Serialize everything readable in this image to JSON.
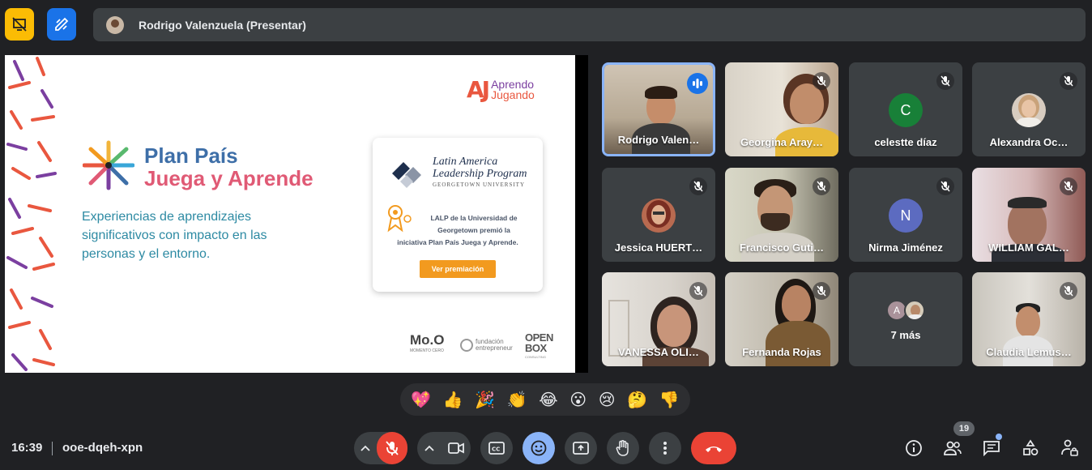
{
  "header": {
    "presenter_label": "Rodrigo Valenzuela (Presentar)",
    "left_buttons": [
      "present-off-icon",
      "whiteboard-icon"
    ]
  },
  "slide": {
    "brand_top_right": {
      "mark": "AJ",
      "line1": "Aprendo",
      "line2": "Jugando"
    },
    "title_line1": "Plan País",
    "title_line2": "Juega y Aprende",
    "subtitle_lines": [
      "Experiencias de aprendizajes",
      "significativos con impacto en las",
      "personas y el entorno."
    ],
    "card": {
      "program_line1": "Latin America",
      "program_line2": "Leadership Program",
      "university": "GEORGETOWN UNIVERSITY",
      "text_lines": [
        "LALP de la Universidad de",
        "Georgetown premió la",
        "iniciativa Plan País Juega y Aprende."
      ],
      "button": "Ver premiación"
    },
    "sponsors": {
      "mo": "Mo.O",
      "mo_sub": "MOMENTO CERO",
      "fundacion_1": "fundación",
      "fundacion_2": "entrepreneur",
      "openbox_1": "OPEN",
      "openbox_2": "BOX",
      "openbox_sub": "CONSULTING"
    }
  },
  "participants": [
    {
      "name": "Rodrigo Valen…",
      "type": "video",
      "speaking": true
    },
    {
      "name": "Georgina Aray…",
      "type": "video",
      "muted": true
    },
    {
      "name": "celestte díaz",
      "type": "letter",
      "letter": "C",
      "color": "#188038",
      "muted": true
    },
    {
      "name": "Alexandra Oc…",
      "type": "photo",
      "muted": true
    },
    {
      "name": "Jessica HUERT…",
      "type": "photo",
      "muted": true
    },
    {
      "name": "Francisco Guti…",
      "type": "video",
      "muted": true
    },
    {
      "name": "Nirma Jiménez",
      "type": "letter",
      "letter": "N",
      "color": "#5c6bc0",
      "muted": true
    },
    {
      "name": "WILLIAM GAL…",
      "type": "video",
      "muted": true
    },
    {
      "name": "VANESSA OLI…",
      "type": "video",
      "muted": true
    },
    {
      "name": "Fernanda Rojas",
      "type": "video",
      "muted": true
    },
    {
      "name": "7 más",
      "type": "more",
      "letter": "A"
    },
    {
      "name": "Claudia Lemus…",
      "type": "video",
      "muted": true
    }
  ],
  "reactions": [
    "💖",
    "👍",
    "🎉",
    "👏",
    "😂",
    "😮",
    "😢",
    "🤔",
    "👎"
  ],
  "footer": {
    "time": "16:39",
    "meeting_code": "ooe-dqeh-xpn",
    "participant_count": "19"
  }
}
